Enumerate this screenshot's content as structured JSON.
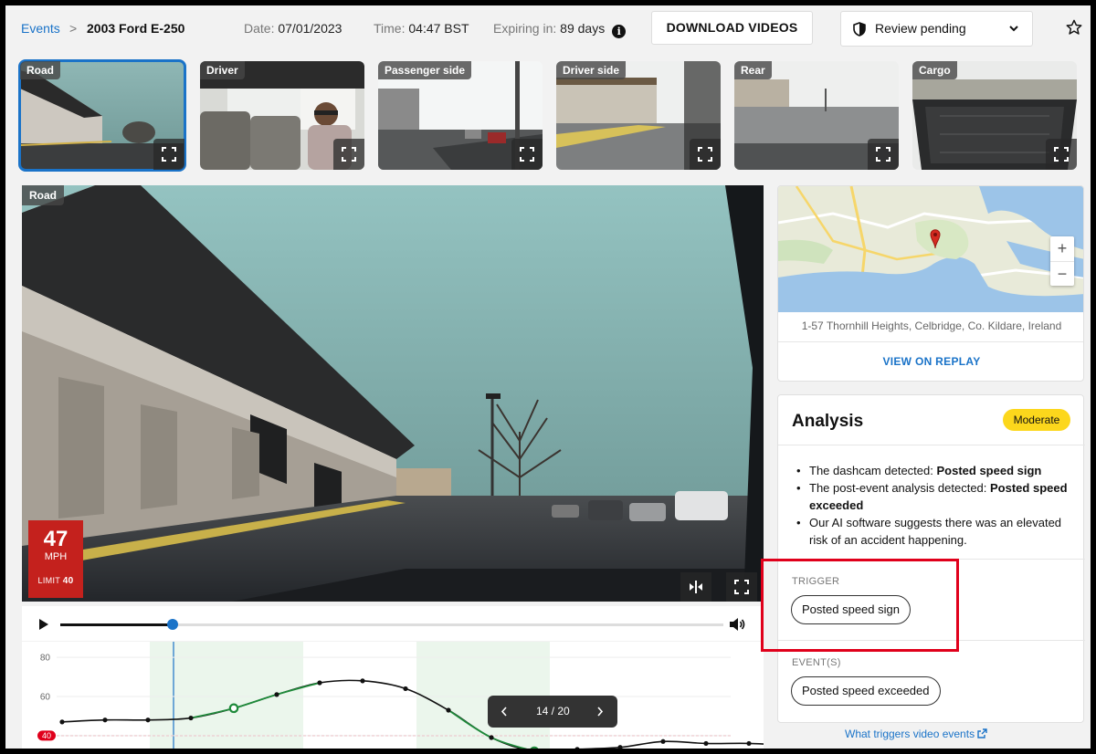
{
  "breadcrumb": {
    "parent": "Events",
    "separator": ">",
    "current": "2003 Ford E-250"
  },
  "meta": {
    "date_label": "Date:",
    "date_value": "07/01/2023",
    "time_label": "Time:",
    "time_value": "04:47 BST",
    "expiry_label": "Expiring in:",
    "expiry_value": "89 days",
    "info_glyph": "i"
  },
  "toolbar": {
    "download_label": "DOWNLOAD VIDEOS",
    "review_label": "Review pending"
  },
  "thumbnails": [
    {
      "label": "Road"
    },
    {
      "label": "Driver"
    },
    {
      "label": "Passenger side"
    },
    {
      "label": "Driver side"
    },
    {
      "label": "Rear"
    },
    {
      "label": "Cargo"
    }
  ],
  "video": {
    "label": "Road",
    "speed_value": "47",
    "speed_unit": "MPH",
    "limit_label": "LIMIT",
    "limit_value": "40"
  },
  "player": {
    "progress": 0.17
  },
  "chart_data": {
    "type": "line",
    "y_ticks": [
      "80",
      "60",
      "40"
    ],
    "limit_marker": "40",
    "limit_value": 40,
    "ylim": [
      32,
      88
    ],
    "series": [
      {
        "values": [
          47,
          48,
          48,
          49,
          54,
          61,
          67,
          68,
          64,
          53,
          39,
          32,
          33,
          34,
          37,
          36,
          36,
          35
        ]
      }
    ]
  },
  "pager": {
    "current": "14",
    "total": "20",
    "text": "14 / 20"
  },
  "map": {
    "address": "1-57 Thornhill Heights, Celbridge, Co. Kildare, Ireland",
    "replay_label": "VIEW ON REPLAY",
    "zoom_in": "+",
    "zoom_out": "−"
  },
  "analysis": {
    "title": "Analysis",
    "severity": "Moderate",
    "items": [
      {
        "text": "The dashcam detected: ",
        "strong": "Posted speed sign"
      },
      {
        "text": "The post-event analysis detected: ",
        "strong": "Posted speed exceeded"
      },
      {
        "text": "Our AI software suggests there was an elevated risk of an accident happening.",
        "strong": ""
      }
    ],
    "trigger_heading": "TRIGGER",
    "trigger_chip": "Posted speed sign",
    "events_heading": "EVENT(S)",
    "events_chip": "Posted speed exceeded"
  },
  "help_link": "What triggers video events",
  "colors": {
    "accent": "#1a73c8",
    "danger": "#c4211d",
    "badge": "#fcd71c",
    "chart_green": "#1e8a3a"
  }
}
